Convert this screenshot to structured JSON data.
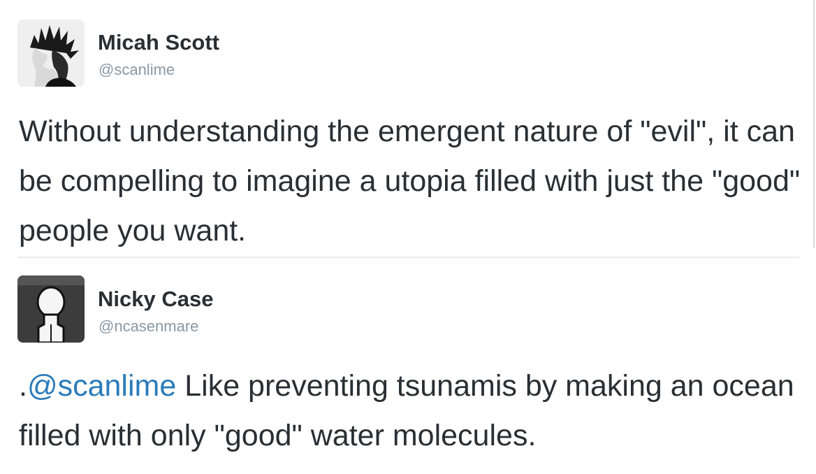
{
  "tweets": [
    {
      "author": {
        "name": "Micah Scott",
        "handle": "@scanlime",
        "avatar_icon": "user-avatar-photo"
      },
      "text": "Without understanding the emergent nature of \"evil\", it can be compelling to imagine a utopia filled with just the \"good\" people you want."
    },
    {
      "author": {
        "name": "Nicky Case",
        "handle": "@ncasenmare",
        "avatar_icon": "person-silhouette-avatar"
      },
      "text_prefix": ".",
      "mention": "@scanlime",
      "text": " Like preventing tsunamis by making an ocean filled with only \"good\" water molecules."
    }
  ],
  "colors": {
    "text": "#292f33",
    "handle": "#8899a6",
    "mention": "#2b7bb9",
    "divider": "#e6ecf0"
  }
}
